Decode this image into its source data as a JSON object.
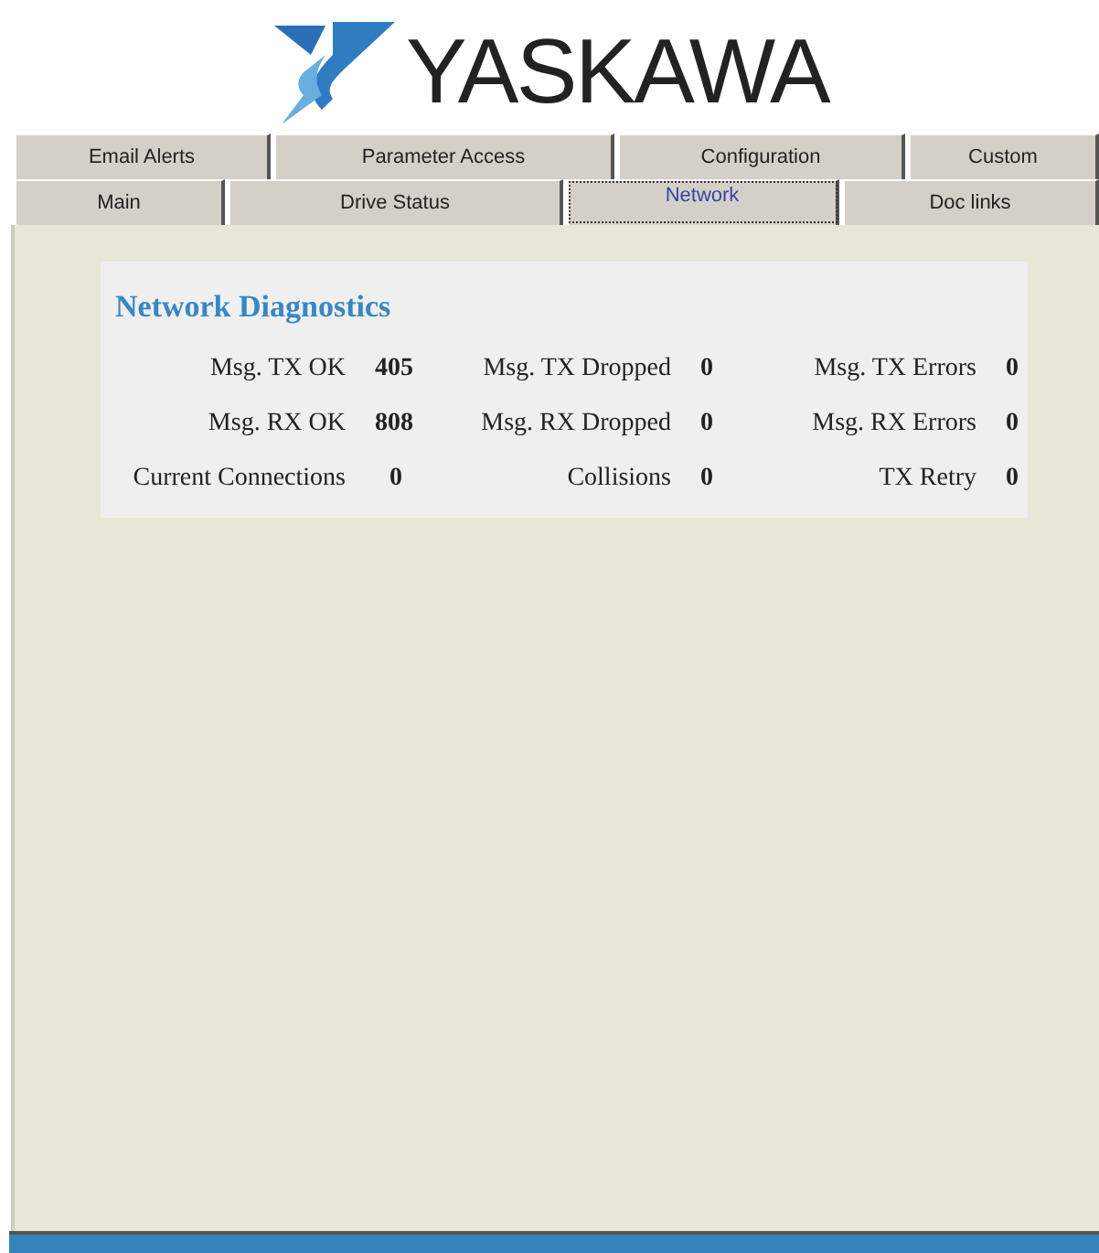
{
  "logo": {
    "text": "YASKAWA"
  },
  "tab_rows": [
    {
      "tabs": [
        {
          "label": "Email Alerts",
          "selected": false
        },
        {
          "label": "Parameter Access",
          "selected": false
        },
        {
          "label": "Configuration",
          "selected": false
        },
        {
          "label": "Custom",
          "selected": false
        }
      ]
    },
    {
      "tabs": [
        {
          "label": "Main",
          "selected": false
        },
        {
          "label": "Drive Status",
          "selected": false
        },
        {
          "label": "Network",
          "selected": true
        },
        {
          "label": "Doc links",
          "selected": false
        }
      ]
    }
  ],
  "panel": {
    "title": "Network Diagnostics",
    "rows": [
      [
        {
          "label": "Msg. TX OK",
          "value": "405"
        },
        {
          "label": "Msg. TX Dropped",
          "value": "0"
        },
        {
          "label": "Msg. TX Errors",
          "value": "0"
        }
      ],
      [
        {
          "label": "Msg. RX OK",
          "value": "808"
        },
        {
          "label": "Msg. RX Dropped",
          "value": "0"
        },
        {
          "label": "Msg. RX Errors",
          "value": "0"
        }
      ],
      [
        {
          "label": "Current Connections",
          "value": "0"
        },
        {
          "label": "Collisions",
          "value": "0"
        },
        {
          "label": "TX Retry",
          "value": "0"
        }
      ]
    ]
  }
}
